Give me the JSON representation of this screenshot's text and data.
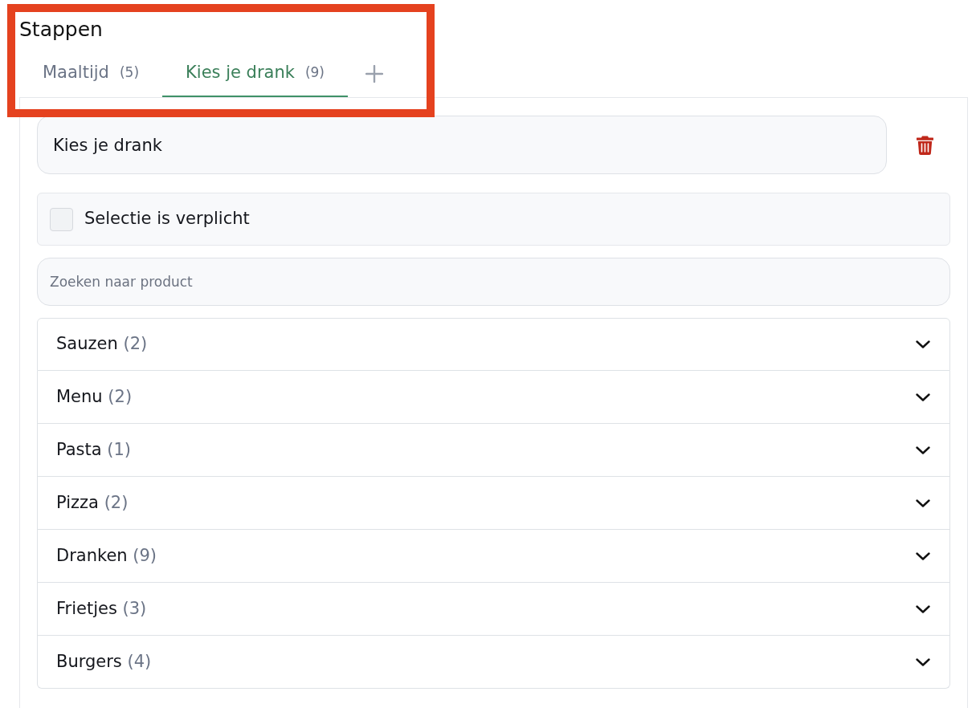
{
  "highlight": {
    "kind": "frame"
  },
  "section_title": "Stappen",
  "tabs": [
    {
      "label": "Maaltijd",
      "count": "(5)",
      "selected": false
    },
    {
      "label": "Kies je drank",
      "count": "(9)",
      "selected": true
    }
  ],
  "step": {
    "name": "Kies je drank",
    "required": {
      "label": "Selectie is verplicht",
      "checked": false
    },
    "search": {
      "placeholder": "Zoeken naar product"
    },
    "categories": [
      {
        "name": "Sauzen",
        "count": "(2)",
        "expanded": false
      },
      {
        "name": "Menu",
        "count": "(2)",
        "expanded": false
      },
      {
        "name": "Pasta",
        "count": "(1)",
        "expanded": false
      },
      {
        "name": "Pizza",
        "count": "(2)",
        "expanded": false
      },
      {
        "name": "Dranken",
        "count": "(9)",
        "expanded": false
      },
      {
        "name": "Frietjes",
        "count": "(3)",
        "expanded": false
      },
      {
        "name": "Burgers",
        "count": "(4)",
        "expanded": false
      }
    ]
  }
}
